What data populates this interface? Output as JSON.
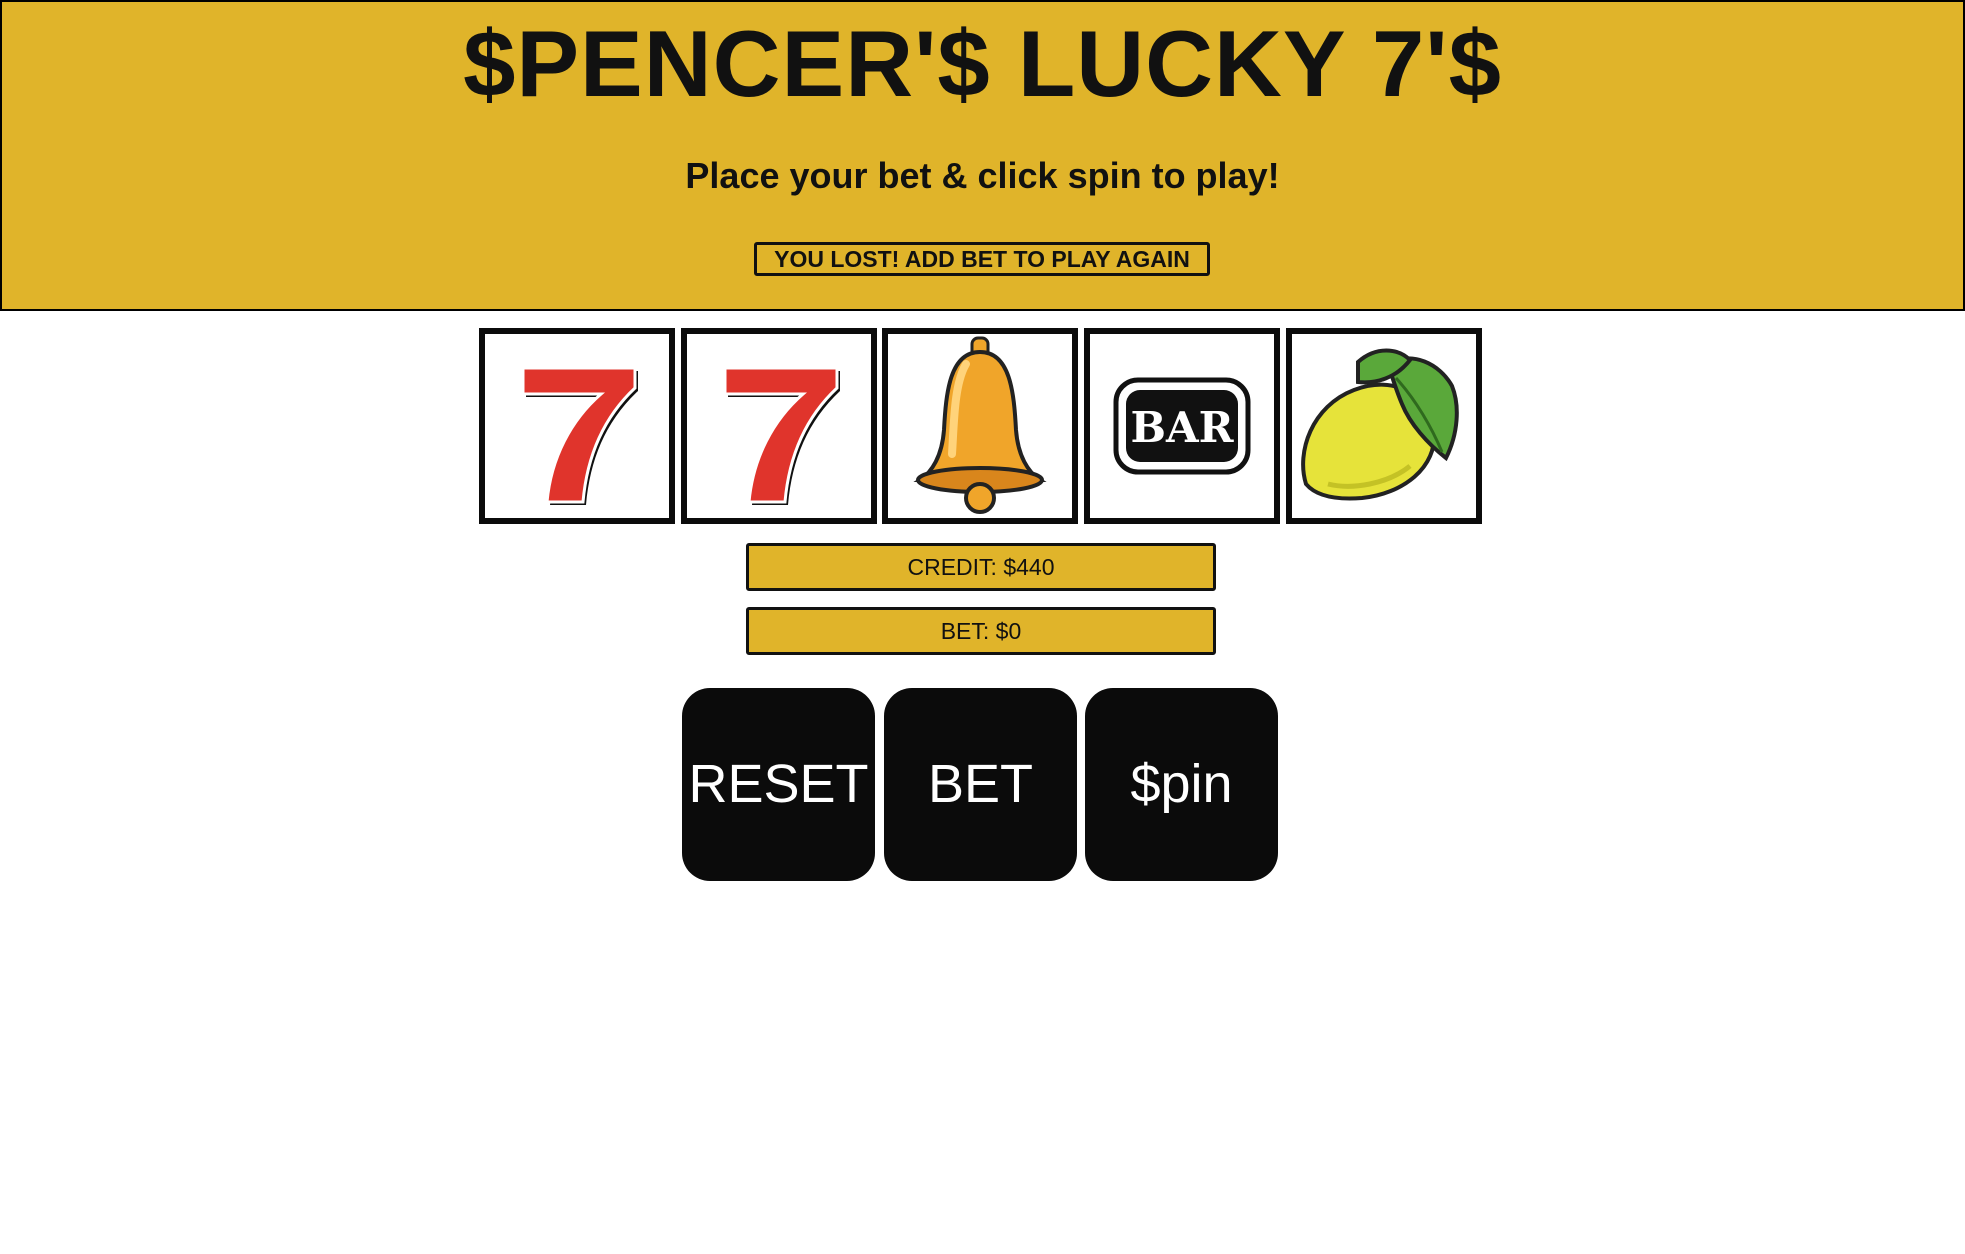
{
  "header": {
    "title": "$PENCER'$ LUCKY 7'$",
    "subtitle": "Place your bet & click spin to play!",
    "status_message": "YOU LOST! ADD BET TO PLAY AGAIN"
  },
  "reels": [
    {
      "symbol": "seven"
    },
    {
      "symbol": "seven"
    },
    {
      "symbol": "bell"
    },
    {
      "symbol": "bar",
      "label": "BAR"
    },
    {
      "symbol": "lemon"
    }
  ],
  "meters": {
    "credit": "CREDIT: $440",
    "bet": "BET: $0"
  },
  "buttons": {
    "reset": "RESET",
    "bet": "BET",
    "spin": "$pin"
  },
  "colors": {
    "gold": "#e0b42a",
    "black": "#0b0b0b",
    "seven_red": "#e0342c",
    "bell_orange": "#f0a52a",
    "lemon_yellow": "#e6e33a",
    "leaf_green": "#5aa83a"
  }
}
